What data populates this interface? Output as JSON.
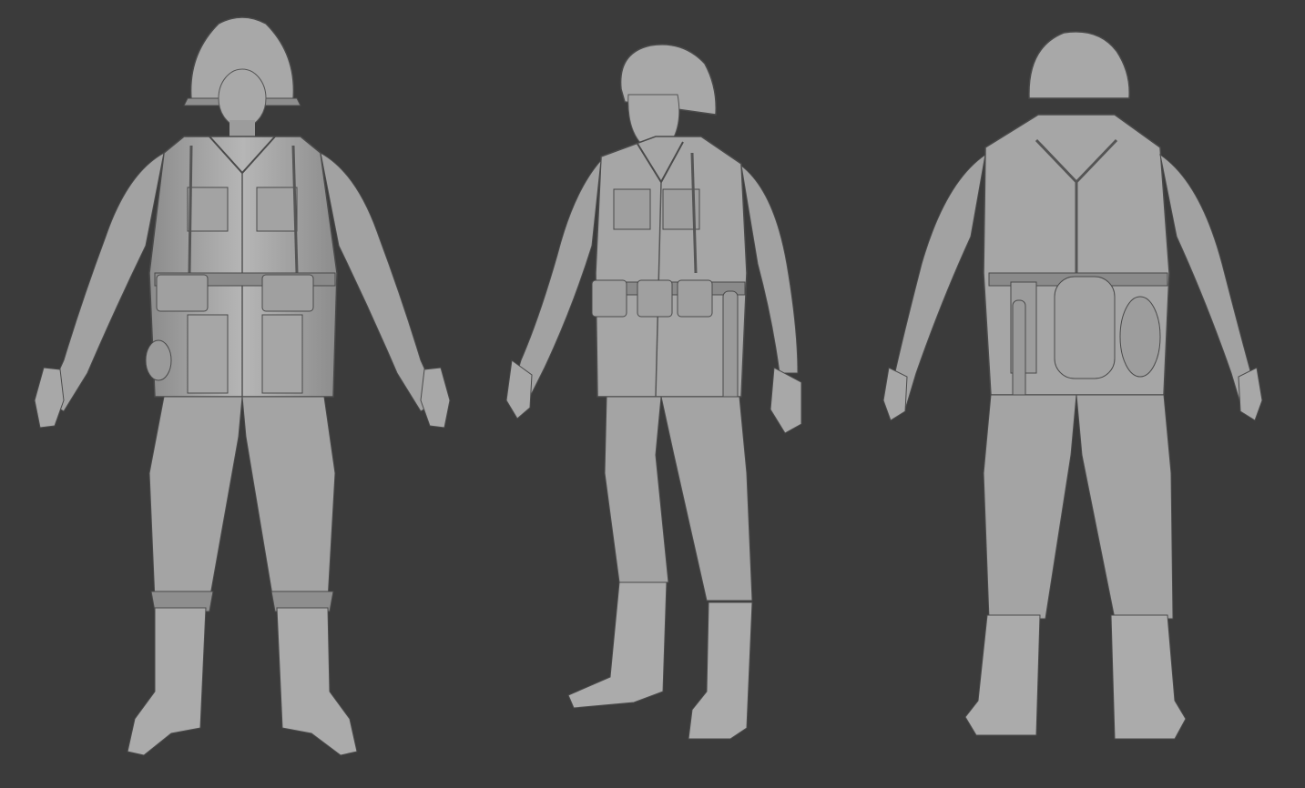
{
  "scene": {
    "background_color": "#3b3b3b",
    "subject": "soldier-clay-render",
    "views": [
      {
        "name": "front-view"
      },
      {
        "name": "three-quarter-view"
      },
      {
        "name": "back-view"
      }
    ],
    "clay_colors": {
      "light": "#b4b4b4",
      "mid": "#9a9a9a",
      "dark": "#6c6c6c",
      "line": "#4a4a4a"
    }
  }
}
